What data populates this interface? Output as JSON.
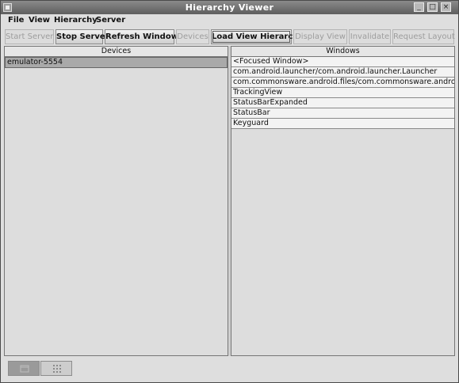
{
  "window": {
    "title": "Hierarchy Viewer"
  },
  "menu": {
    "file": "File",
    "view": "View",
    "hierarchy": "Hierarchy",
    "server": "Server"
  },
  "toolbar": {
    "start_server": "Start Server",
    "stop_server": "Stop Server",
    "refresh_windows": "Refresh Windows",
    "devices": "Devices",
    "load_view_hierarchy": "Load View Hierarchy",
    "display_view": "Display View",
    "invalidate": "Invalidate",
    "request_layout": "Request Layout"
  },
  "devices_panel": {
    "header": "Devices",
    "items": [
      "emulator-5554"
    ]
  },
  "windows_panel": {
    "header": "Windows",
    "items": [
      "<Focused Window>",
      "com.android.launcher/com.android.launcher.Launcher",
      "com.commonsware.android.files/com.commonsware.android.f...",
      "TrackingView",
      "StatusBarExpanded",
      "StatusBar",
      "Keyguard"
    ]
  },
  "statusbar": {
    "icons": [
      "window-list-icon",
      "pixel-perfect-icon"
    ]
  }
}
